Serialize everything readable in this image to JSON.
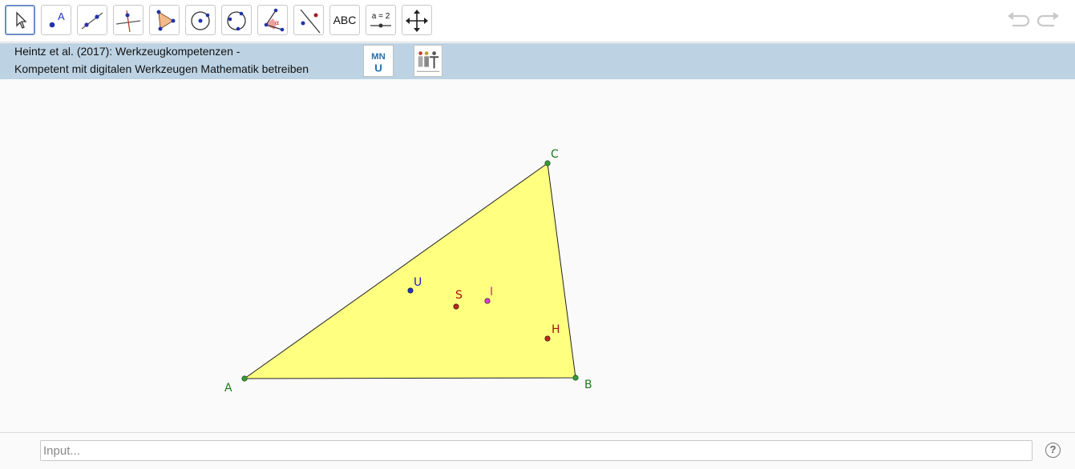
{
  "toolbar": {
    "tools": [
      {
        "name": "move-tool",
        "label": ""
      },
      {
        "name": "point-tool",
        "label": "A"
      },
      {
        "name": "line-tool",
        "label": ""
      },
      {
        "name": "perpendicular-line-tool",
        "label": ""
      },
      {
        "name": "polygon-tool",
        "label": ""
      },
      {
        "name": "circle-center-point-tool",
        "label": ""
      },
      {
        "name": "circle-through-points-tool",
        "label": ""
      },
      {
        "name": "angle-tool",
        "label": "α"
      },
      {
        "name": "reflect-tool",
        "label": ""
      },
      {
        "name": "text-tool",
        "label": "ABC"
      },
      {
        "name": "slider-tool",
        "label": "a = 2"
      },
      {
        "name": "move-graphics-view-tool",
        "label": ""
      }
    ],
    "selected_tool": "move-tool"
  },
  "banner": {
    "line1": "Heintz et al. (2017): Werkzeugkompetenzen -",
    "line2": "Kompetent mit digitalen Werkzeugen Mathematik betreiben",
    "logo1_text": "MNU"
  },
  "construction": {
    "points": [
      {
        "label": "A",
        "color": "#1a7a1a"
      },
      {
        "label": "B",
        "color": "#1a7a1a"
      },
      {
        "label": "C",
        "color": "#1a7a1a"
      },
      {
        "label": "U",
        "color": "#1a1ad0"
      },
      {
        "label": "S",
        "color": "#a0140c"
      },
      {
        "label": "I",
        "color": "#d020c0"
      },
      {
        "label": "H",
        "color": "#a0140c"
      }
    ],
    "triangle_fill": "#ffff80"
  },
  "input": {
    "placeholder": "Input..."
  },
  "help": {
    "label": "?"
  }
}
